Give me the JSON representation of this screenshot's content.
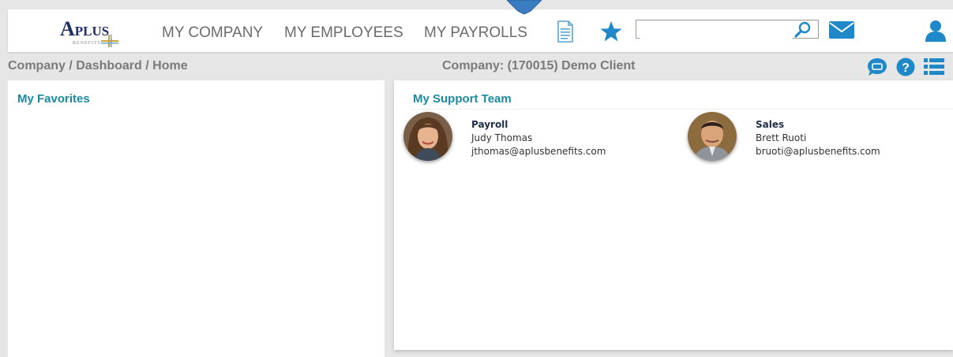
{
  "logo": {
    "brand_big": "A",
    "brand_small": "PLUS",
    "tagline": "BENEFITS"
  },
  "nav": {
    "items": [
      "MY COMPANY",
      "MY EMPLOYEES",
      "MY PAYROLLS"
    ]
  },
  "toolbar_icons": {
    "document": "document-icon",
    "favorites": "star-icon",
    "search": "search-icon",
    "mail": "mail-icon",
    "user": "user-icon"
  },
  "search": {
    "value": "",
    "placeholder": ""
  },
  "subbar": {
    "breadcrumb": "Company / Dashboard / Home",
    "company": "Company: (170015) Demo Client",
    "icons": [
      "chat-icon",
      "help-icon",
      "list-icon"
    ]
  },
  "favorites": {
    "title": "My Favorites"
  },
  "support": {
    "title": "My Support Team",
    "members": [
      {
        "role": "Payroll",
        "name": "Judy Thomas",
        "email": "jthomas@aplusbenefits.com"
      },
      {
        "role": "Sales",
        "name": "Brett Ruoti",
        "email": "bruoti@aplusbenefits.com"
      }
    ]
  },
  "colors": {
    "accent": "#1a8aa3",
    "icon_blue": "#1e88c9",
    "nav_text": "#6b6b6b",
    "background": "#e6e6e6"
  }
}
